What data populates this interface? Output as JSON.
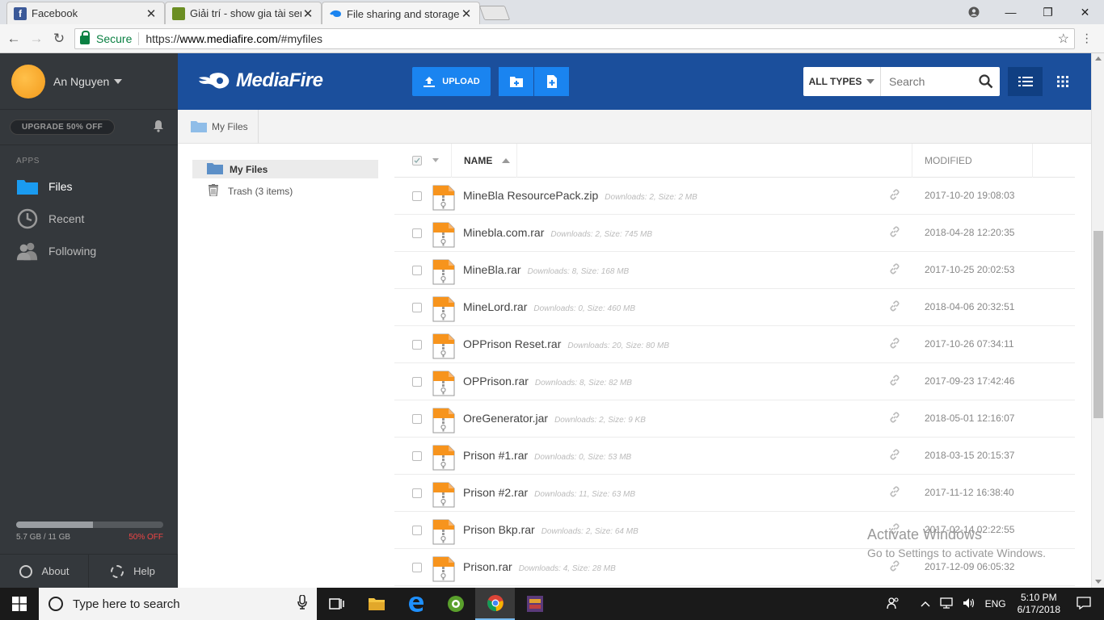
{
  "browser": {
    "tabs": [
      {
        "title": "Facebook",
        "favicon": "facebook-icon",
        "color": "#3b5998"
      },
      {
        "title": "Giải trí - show gia tài serv",
        "favicon": "minecraft-icon",
        "color": "#6b8e23"
      },
      {
        "title": "File sharing and storage m",
        "favicon": "mediafire-icon",
        "color": "#1a84f0"
      }
    ],
    "secure_label": "Secure",
    "url_scheme": "https://",
    "url_host": "www.mediafire.com",
    "url_path": "/#myfiles"
  },
  "sidebar": {
    "user_name": "An Nguyen",
    "upgrade_label": "UPGRADE 50% OFF",
    "apps_label": "APPS",
    "items": [
      {
        "label": "Files",
        "icon": "folder-icon"
      },
      {
        "label": "Recent",
        "icon": "clock-icon"
      },
      {
        "label": "Following",
        "icon": "people-icon"
      }
    ],
    "storage_used": "5.7 GB / 11 GB",
    "storage_fraction": 0.52,
    "storage_offer": "50% OFF",
    "about_label": "About",
    "help_label": "Help"
  },
  "header": {
    "logo_text": "MediaFire",
    "upload_label": "UPLOAD",
    "types_label": "ALL TYPES",
    "search_placeholder": "Search"
  },
  "breadcrumb": {
    "label": "My Files"
  },
  "tree": {
    "items": [
      {
        "label": "My Files"
      },
      {
        "label": "Trash (3 items)"
      }
    ]
  },
  "list": {
    "col_name": "NAME",
    "col_modified": "MODIFIED",
    "files": [
      {
        "name": "MineBla ResourcePack.zip",
        "meta": "Downloads: 2, Size: 2 MB",
        "modified": "2017-10-20 19:08:03"
      },
      {
        "name": "Minebla.com.rar",
        "meta": "Downloads: 2, Size: 745 MB",
        "modified": "2018-04-28 12:20:35"
      },
      {
        "name": "MineBla.rar",
        "meta": "Downloads: 8, Size: 168 MB",
        "modified": "2017-10-25 20:02:53"
      },
      {
        "name": "MineLord.rar",
        "meta": "Downloads: 0, Size: 460 MB",
        "modified": "2018-04-06 20:32:51"
      },
      {
        "name": "OPPrison Reset.rar",
        "meta": "Downloads: 20, Size: 80 MB",
        "modified": "2017-10-26 07:34:11"
      },
      {
        "name": "OPPrison.rar",
        "meta": "Downloads: 8, Size: 82 MB",
        "modified": "2017-09-23 17:42:46"
      },
      {
        "name": "OreGenerator.jar",
        "meta": "Downloads: 2, Size: 9 KB",
        "modified": "2018-05-01 12:16:07"
      },
      {
        "name": "Prison #1.rar",
        "meta": "Downloads: 0, Size: 53 MB",
        "modified": "2018-03-15 20:15:37"
      },
      {
        "name": "Prison #2.rar",
        "meta": "Downloads: 11, Size: 63 MB",
        "modified": "2017-11-12 16:38:40"
      },
      {
        "name": "Prison Bkp.rar",
        "meta": "Downloads: 2, Size: 64 MB",
        "modified": "2017-02-14 02:22:55"
      },
      {
        "name": "Prison.rar",
        "meta": "Downloads: 4, Size: 28 MB",
        "modified": "2017-12-09 06:05:32"
      }
    ]
  },
  "watermark": {
    "line1": "Activate Windows",
    "line2": "Go to Settings to activate Windows."
  },
  "taskbar": {
    "search_placeholder": "Type here to search",
    "language": "ENG",
    "time": "5:10 PM",
    "date": "6/17/2018"
  },
  "colors": {
    "brand": "#1b4f9c",
    "accent": "#1a84f0",
    "sidebar": "#34383c"
  }
}
